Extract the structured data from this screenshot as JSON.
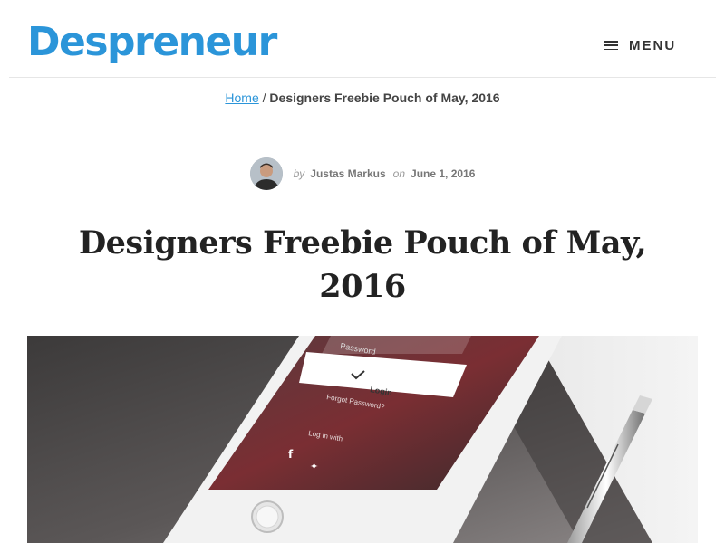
{
  "header": {
    "logo_text": "Despreneur",
    "menu_label": "MENU"
  },
  "breadcrumb": {
    "home": "Home",
    "separator": "/",
    "current": "Designers Freebie Pouch of May, 2016"
  },
  "byline": {
    "by": "by",
    "author": "Justas Markus",
    "on": "on",
    "date": "June 1, 2016"
  },
  "article": {
    "title": "Designers Freebie Pouch of May, 2016"
  },
  "hero": {
    "password_placeholder": "Password",
    "login_label": "Login",
    "forgot_label": "Forgot Password?",
    "login_with_label": "Log in with"
  },
  "colors": {
    "brand": "#2b95d9",
    "text": "#222222",
    "muted": "#888888"
  },
  "icons": [
    "menu-icon",
    "avatar",
    "facebook-icon",
    "twitter-icon",
    "pen"
  ]
}
